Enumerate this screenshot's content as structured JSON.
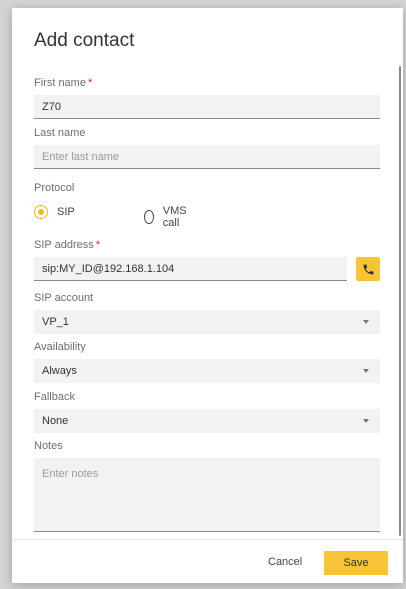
{
  "dialog": {
    "title": "Add contact",
    "accent_color": "#f7c436",
    "required_marker": "*",
    "first_name": {
      "label": "First name",
      "value": "Z70"
    },
    "last_name": {
      "label": "Last name",
      "placeholder": "Enter last name"
    },
    "protocol": {
      "label": "Protocol",
      "options": [
        {
          "label": "SIP",
          "selected": true
        },
        {
          "label": "VMS call",
          "selected": false
        }
      ]
    },
    "sip_address": {
      "label": "SIP address",
      "value": "sip:MY_ID@192.168.1.104",
      "call_icon": "phone-icon"
    },
    "sip_account": {
      "label": "SIP account",
      "value": "VP_1"
    },
    "availability": {
      "label": "Availability",
      "value": "Always"
    },
    "fallback": {
      "label": "Fallback",
      "value": "None"
    },
    "notes": {
      "label": "Notes",
      "placeholder": "Enter notes"
    },
    "buttons": {
      "cancel": "Cancel",
      "save": "Save"
    }
  }
}
